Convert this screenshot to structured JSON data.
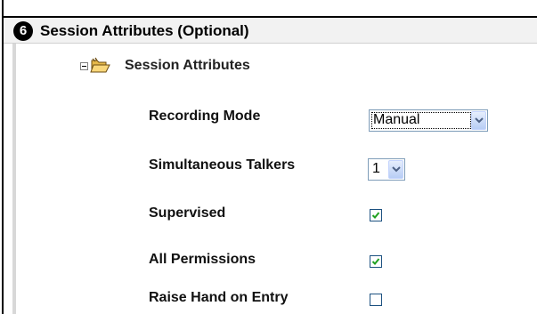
{
  "section": {
    "step_number": "6",
    "title": "Session Attributes (Optional)"
  },
  "tree": {
    "label": "Session Attributes",
    "expand_icon": "minus-box-icon",
    "folder_icon": "open-folder-icon"
  },
  "fields": {
    "recording_mode": {
      "label": "Recording Mode",
      "value": "Manual"
    },
    "simultaneous_talkers": {
      "label": "Simultaneous Talkers",
      "value": "1"
    },
    "supervised": {
      "label": "Supervised",
      "checked": true
    },
    "all_permissions": {
      "label": "All Permissions",
      "checked": true
    },
    "raise_hand": {
      "label": "Raise Hand on Entry",
      "checked": false
    }
  },
  "colors": {
    "header_bg": "#f2f2f2",
    "checkbox_border": "#1c5180",
    "checkmark": "#21a121",
    "dropdown_arrow": "#4d6185"
  }
}
